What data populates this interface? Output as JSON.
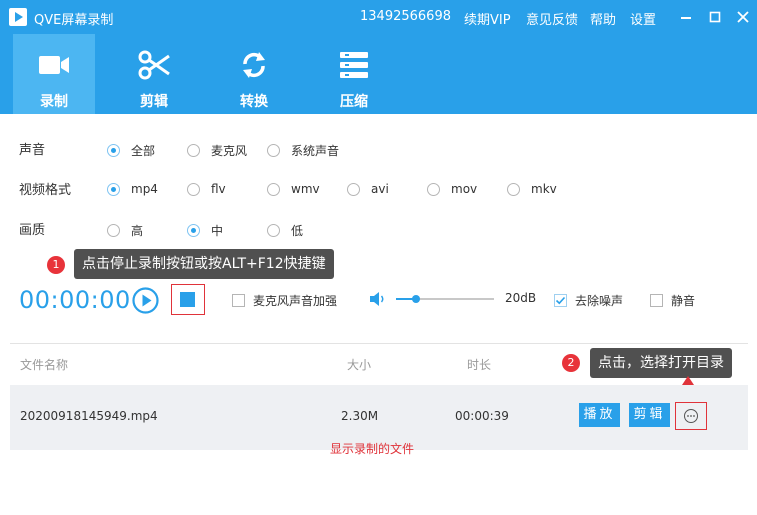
{
  "titlebar": {
    "app_title": "QVE屏幕录制",
    "phone": "13492566698",
    "renew_vip": "续期VIP",
    "feedback": "意见反馈",
    "help": "帮助",
    "settings": "设置"
  },
  "tabs": [
    {
      "label": "录制",
      "icon": "video-camera-icon",
      "active": true
    },
    {
      "label": "剪辑",
      "icon": "scissors-icon",
      "active": false
    },
    {
      "label": "转换",
      "icon": "refresh-icon",
      "active": false
    },
    {
      "label": "压缩",
      "icon": "compress-icon",
      "active": false
    }
  ],
  "options": {
    "sound": {
      "label": "声音",
      "choices": [
        "全部",
        "麦克风",
        "系统声音"
      ],
      "selected": "全部"
    },
    "format": {
      "label": "视频格式",
      "choices": [
        "mp4",
        "flv",
        "wmv",
        "avi",
        "mov",
        "mkv"
      ],
      "selected": "mp4"
    },
    "quality": {
      "label": "画质",
      "choices": [
        "高",
        "中",
        "低"
      ],
      "selected": "中"
    }
  },
  "tips": {
    "tip1_num": "1",
    "tip1_text": "点击停止录制按钮或按ALT+F12快捷键",
    "tip2_num": "2",
    "tip2_text": "点击，选择打开目录"
  },
  "recorder": {
    "timer": "00:00:00",
    "mic_boost": "麦克风声音加强",
    "mic_boost_checked": false,
    "volume_fraction": 0.2,
    "volume_db": "20dB",
    "denoise": "去除噪声",
    "denoise_checked": true,
    "mute": "静音",
    "mute_checked": false
  },
  "table": {
    "headers": {
      "name": "文件名称",
      "size": "大小",
      "duration": "时长"
    },
    "rows": [
      {
        "name": "20200918145949.mp4",
        "size": "2.30M",
        "duration": "00:00:39",
        "play": "播放",
        "edit": "剪辑"
      }
    ],
    "note": "显示录制的文件"
  },
  "colors": {
    "accent": "#29a0e9",
    "annotation_red": "#e0333a",
    "tooltip_bg": "#505050"
  }
}
